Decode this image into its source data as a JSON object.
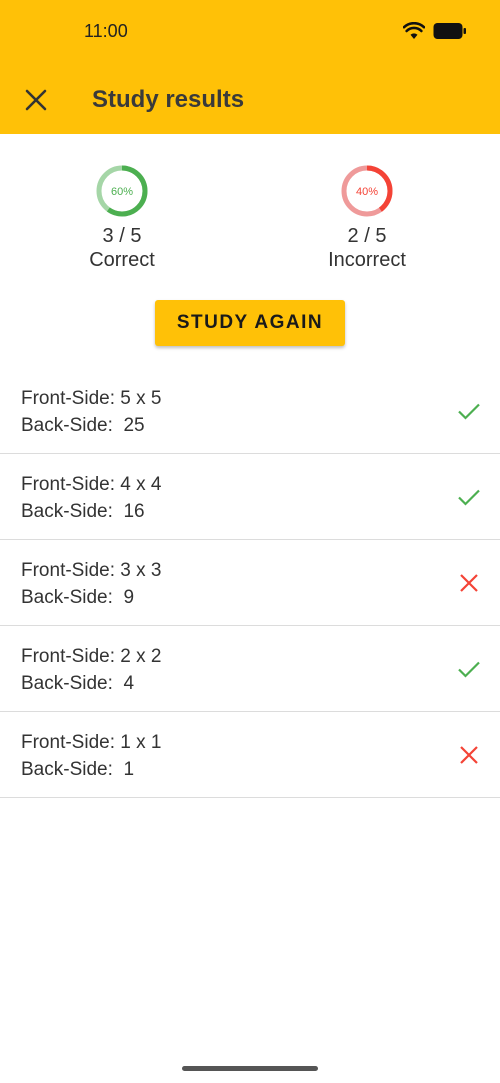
{
  "status": {
    "time": "11:00"
  },
  "header": {
    "title": "Study results",
    "close_icon": "close-icon"
  },
  "stats": {
    "correct": {
      "percent_label": "60%",
      "fraction": 0.6,
      "count": "3 / 5",
      "label": "Correct",
      "color": "#4CAF50",
      "track": "#A5D6A7"
    },
    "incorrect": {
      "percent_label": "40%",
      "fraction": 0.4,
      "count": "2 / 5",
      "label": "Incorrect",
      "color": "#F44336",
      "track": "#EF9A9A"
    }
  },
  "actions": {
    "study_again_label": "STUDY AGAIN"
  },
  "results": [
    {
      "front_label": "Front-Side:",
      "front": "5 x 5",
      "back_label": "Back-Side:",
      "back": "25",
      "correct": true
    },
    {
      "front_label": "Front-Side:",
      "front": "4 x 4",
      "back_label": "Back-Side:",
      "back": "16",
      "correct": true
    },
    {
      "front_label": "Front-Side:",
      "front": "3 x 3",
      "back_label": "Back-Side:",
      "back": "9",
      "correct": false
    },
    {
      "front_label": "Front-Side:",
      "front": "2 x 2",
      "back_label": "Back-Side:",
      "back": "4",
      "correct": true
    },
    {
      "front_label": "Front-Side:",
      "front": "1 x 1",
      "back_label": "Back-Side:",
      "back": "1",
      "correct": false
    }
  ],
  "colors": {
    "accent": "#FFC107",
    "correct_mark": "#4CAF50",
    "incorrect_mark": "#F44336"
  }
}
